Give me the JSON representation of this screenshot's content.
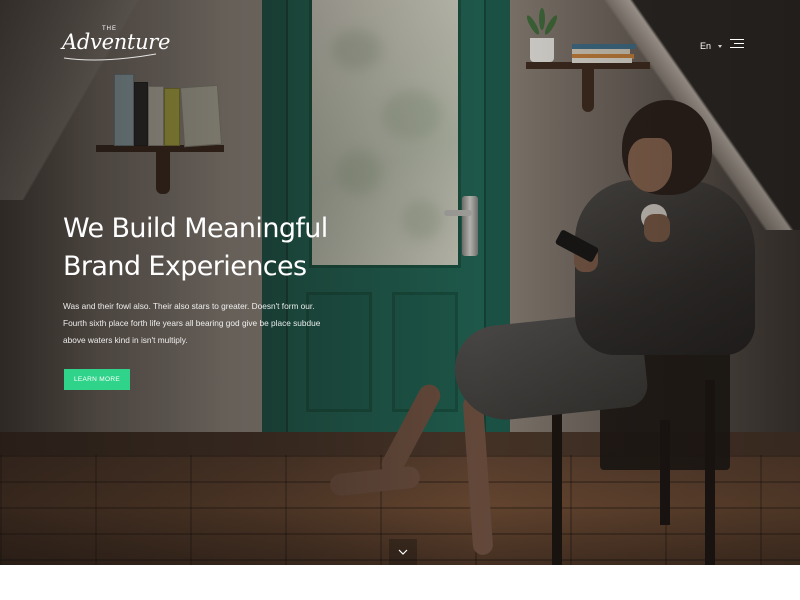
{
  "header": {
    "logo": {
      "small_text": "THE",
      "word": "Adventure"
    },
    "language": "En",
    "menu_icon": "hamburger-menu-icon"
  },
  "hero": {
    "headline_line1": "We Build Meaningful",
    "headline_line2": "Brand Experiences",
    "subtext": "Was and their fowl also. Their also stars to greater. Doesn't form our. Fourth sixth place forth life years all bearing god give be place subdue above waters kind in isn't multiply.",
    "cta_label": "LEARN MORE",
    "scroll_icon": "chevron-down-icon"
  },
  "colors": {
    "accent": "#2fd38a",
    "text": "#ffffff",
    "door_green": "#1f6252"
  }
}
